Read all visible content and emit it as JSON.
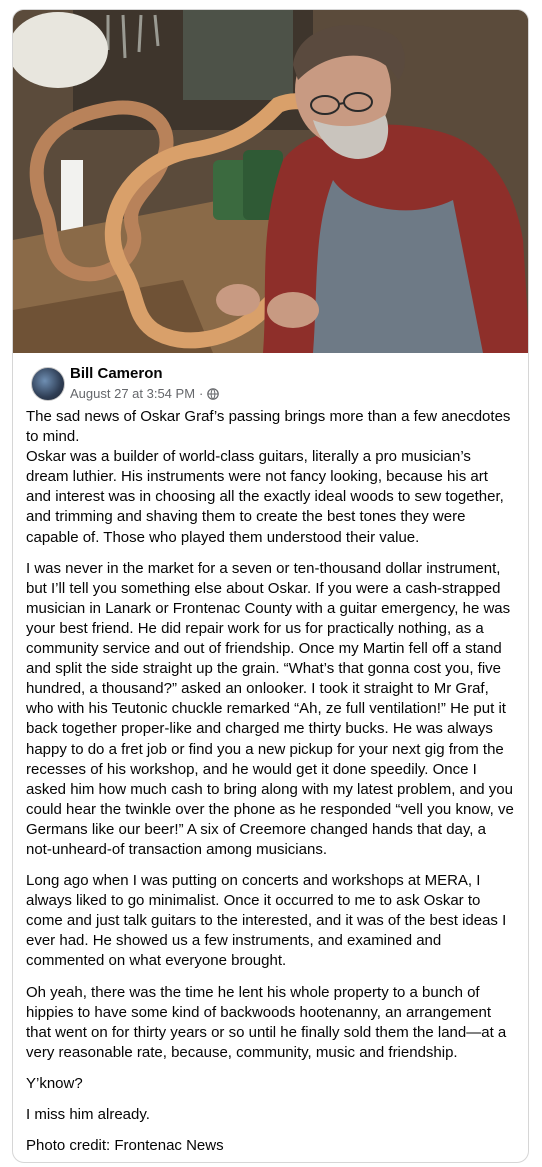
{
  "post": {
    "author": "Bill Cameron",
    "timestamp": "August 27 at 3:54 PM",
    "separator": "·",
    "privacy_icon": "globe-icon",
    "photo_description_icon": "photo",
    "paragraphs": [
      "The sad news of Oskar Graf’s passing brings more than a few anecdotes to mind.\nOskar was a builder of world-class guitars, literally a pro musician’s dream luthier. His instruments were not fancy looking, because his art and interest was in choosing all the exactly ideal woods to sew together, and trimming and shaving them to create the best tones they were capable of.  Those who played them understood their value.",
      "I was never in the market for a seven or ten-thousand dollar instrument, but I’ll tell you something else about Oskar.  If you were a cash-strapped musician in Lanark or Frontenac County with a guitar emergency, he was your best friend.  He did repair work for us for practically nothing, as a community service and out of friendship. Once my Martin fell off a stand and split the side straight up the grain. “What’s that gonna cost you, five hundred, a thousand?” asked an onlooker. I took it straight to Mr Graf, who with his Teutonic chuckle remarked “Ah, ze full ventilation!”   He put it back together proper-like and charged me thirty bucks.  He was always happy to do a fret job or find you a new pickup for your next gig from the recesses of his workshop, and he would get it done speedily. Once I asked him how much cash to bring along with my latest problem, and you could hear the twinkle over the phone as he responded “vell you know, ve Germans like our beer!”  A six of Creemore changed hands that day, a not-unheard-of transaction among musicians.",
      "Long ago when I was putting on concerts and workshops at MERA, I always liked to go minimalist. Once it occurred to me to ask Oskar to come and just talk guitars to the interested, and it was of the best ideas I ever had. He showed us a few instruments, and examined and commented on what everyone brought.",
      "Oh yeah, there was the time he lent his whole property to a bunch of hippies to have some kind of backwoods hootenanny, an arrangement that went on for thirty years or so until he finally sold them the land—at a very reasonable rate, because, community, music and friendship.",
      "Y’know?",
      "I miss him already.",
      "Photo credit: Frontenac News"
    ]
  },
  "colors": {
    "text": "#050505",
    "meta": "#65676b",
    "border": "#d6d6d6"
  }
}
